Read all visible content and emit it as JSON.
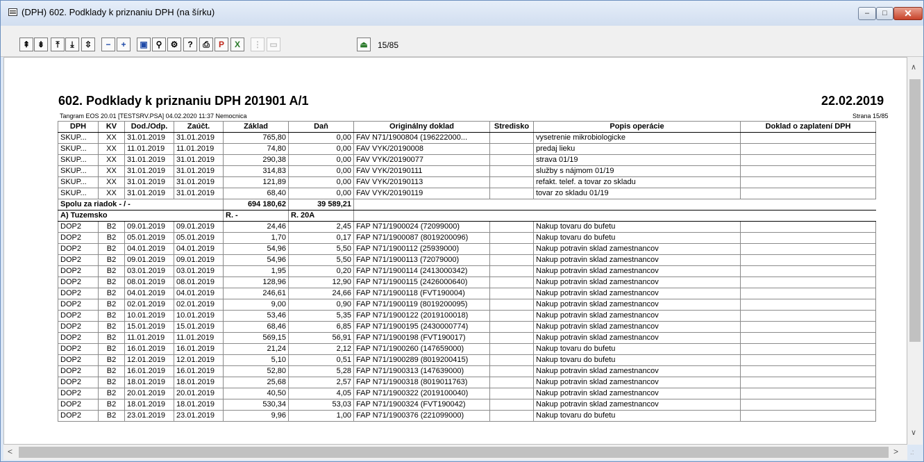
{
  "window": {
    "title": "(DPH) 602. Podklady k priznaniu DPH (na šírku)",
    "min_label": "–",
    "max_label": "□",
    "close_label": "✕"
  },
  "toolbar": {
    "buttons": [
      {
        "name": "first-page-icon",
        "glyph": "⇞"
      },
      {
        "name": "last-page-icon",
        "glyph": "⇟"
      },
      {
        "name": "prev-page-icon",
        "glyph": "⤒"
      },
      {
        "name": "next-page-icon",
        "glyph": "⤓"
      },
      {
        "name": "goto-page-icon",
        "glyph": "⇳"
      },
      {
        "name": "zoom-out-icon",
        "glyph": "−"
      },
      {
        "name": "zoom-in-icon",
        "glyph": "+"
      },
      {
        "name": "screen-icon",
        "glyph": "▣"
      },
      {
        "name": "search-icon",
        "glyph": "⚲"
      },
      {
        "name": "page-setup-icon",
        "glyph": "⚙"
      },
      {
        "name": "help-icon",
        "glyph": "?"
      },
      {
        "name": "print-icon",
        "glyph": "⎙"
      },
      {
        "name": "pdf-export-icon",
        "glyph": "P"
      },
      {
        "name": "excel-export-icon",
        "glyph": "X"
      },
      {
        "name": "disabled-tool-icon",
        "glyph": "⋮"
      },
      {
        "name": "disabled-doc-icon",
        "glyph": "▭"
      },
      {
        "name": "exit-icon",
        "glyph": "⏏"
      }
    ],
    "page_count": "15/85"
  },
  "report": {
    "title": "602. Podklady k priznaniu DPH 201901 A/1",
    "date": "22.02.2019",
    "subtitle": "Tangram EOS 20.01 [TESTSRV.PSA] 04.02.2020 11:37  Nemocnica",
    "page": "Strana 15/85",
    "columns": [
      "DPH",
      "KV",
      "Dod./Odp.",
      "Zaúčt.",
      "Základ",
      "Daň",
      "Originálny doklad",
      "Stredisko",
      "Popis operácie",
      "Doklad o zaplatení DPH"
    ],
    "rows_top": [
      [
        "SKUP...",
        "XX",
        "31.01.2019",
        "31.01.2019",
        "765,80",
        "0,00",
        "FAV N71/1900804 (196222000...",
        "",
        "vysetrenie mikrobiologicke",
        ""
      ],
      [
        "SKUP...",
        "XX",
        "11.01.2019",
        "11.01.2019",
        "74,80",
        "0,00",
        "FAV VYK/20190008",
        "",
        "predaj lieku",
        ""
      ],
      [
        "SKUP...",
        "XX",
        "31.01.2019",
        "31.01.2019",
        "290,38",
        "0,00",
        "FAV VYK/20190077",
        "",
        "strava 01/19",
        ""
      ],
      [
        "SKUP...",
        "XX",
        "31.01.2019",
        "31.01.2019",
        "314,83",
        "0,00",
        "FAV VYK/20190111",
        "",
        "služby s nájmom 01/19",
        ""
      ],
      [
        "SKUP...",
        "XX",
        "31.01.2019",
        "31.01.2019",
        "121,89",
        "0,00",
        "FAV VYK/20190113",
        "",
        "refakt. telef. a tovar zo skladu",
        ""
      ],
      [
        "SKUP...",
        "XX",
        "31.01.2019",
        "31.01.2019",
        "68,40",
        "0,00",
        "FAV VYK/20190119",
        "",
        "tovar zo skladu 01/19",
        ""
      ]
    ],
    "total": {
      "label": "Spolu za riadok - / -",
      "zaklad": "694 180,62",
      "dan": "39 589,21"
    },
    "section": {
      "label": "A) Tuzemsko",
      "r1": "R. -",
      "r2": "R. 20A"
    },
    "rows_bottom": [
      [
        "DOP2",
        "B2",
        "09.01.2019",
        "09.01.2019",
        "24,46",
        "2,45",
        "FAP N71/1900024 (72099000)",
        "",
        "Nakup tovaru do bufetu",
        ""
      ],
      [
        "DOP2",
        "B2",
        "05.01.2019",
        "05.01.2019",
        "1,70",
        "0,17",
        "FAP N71/1900087 (8019200096)",
        "",
        "Nakup tovaru do bufetu",
        ""
      ],
      [
        "DOP2",
        "B2",
        "04.01.2019",
        "04.01.2019",
        "54,96",
        "5,50",
        "FAP N71/1900112 (25939000)",
        "",
        "Nakup potravin sklad zamestnancov",
        ""
      ],
      [
        "DOP2",
        "B2",
        "09.01.2019",
        "09.01.2019",
        "54,96",
        "5,50",
        "FAP N71/1900113 (72079000)",
        "",
        "Nakup potravin sklad zamestnancov",
        ""
      ],
      [
        "DOP2",
        "B2",
        "03.01.2019",
        "03.01.2019",
        "1,95",
        "0,20",
        "FAP N71/1900114 (2413000342)",
        "",
        "Nakup potravin sklad zamestnancov",
        ""
      ],
      [
        "DOP2",
        "B2",
        "08.01.2019",
        "08.01.2019",
        "128,96",
        "12,90",
        "FAP N71/1900115 (2426000640)",
        "",
        "Nakup potravin sklad zamestnancov",
        ""
      ],
      [
        "DOP2",
        "B2",
        "04.01.2019",
        "04.01.2019",
        "246,61",
        "24,66",
        "FAP N71/1900118 (FVT190004)",
        "",
        "Nakup potravin sklad zamestnancov",
        ""
      ],
      [
        "DOP2",
        "B2",
        "02.01.2019",
        "02.01.2019",
        "9,00",
        "0,90",
        "FAP N71/1900119 (8019200095)",
        "",
        "Nakup potravin sklad zamestnancov",
        ""
      ],
      [
        "DOP2",
        "B2",
        "10.01.2019",
        "10.01.2019",
        "53,46",
        "5,35",
        "FAP N71/1900122 (2019100018)",
        "",
        "Nakup potravin sklad zamestnancov",
        ""
      ],
      [
        "DOP2",
        "B2",
        "15.01.2019",
        "15.01.2019",
        "68,46",
        "6,85",
        "FAP N71/1900195 (2430000774)",
        "",
        "Nakup potravin sklad zamestnancov",
        ""
      ],
      [
        "DOP2",
        "B2",
        "11.01.2019",
        "11.01.2019",
        "569,15",
        "56,91",
        "FAP N71/1900198 (FVT190017)",
        "",
        "Nakup potravin sklad zamestnancov",
        ""
      ],
      [
        "DOP2",
        "B2",
        "16.01.2019",
        "16.01.2019",
        "21,24",
        "2,12",
        "FAP N71/1900260 (147659000)",
        "",
        "Nakup tovaru do bufetu",
        ""
      ],
      [
        "DOP2",
        "B2",
        "12.01.2019",
        "12.01.2019",
        "5,10",
        "0,51",
        "FAP N71/1900289 (8019200415)",
        "",
        "Nakup tovaru do bufetu",
        ""
      ],
      [
        "DOP2",
        "B2",
        "16.01.2019",
        "16.01.2019",
        "52,80",
        "5,28",
        "FAP N71/1900313 (147639000)",
        "",
        "Nakup potravin sklad zamestnancov",
        ""
      ],
      [
        "DOP2",
        "B2",
        "18.01.2019",
        "18.01.2019",
        "25,68",
        "2,57",
        "FAP N71/1900318 (8019011763)",
        "",
        "Nakup potravin sklad zamestnancov",
        ""
      ],
      [
        "DOP2",
        "B2",
        "20.01.2019",
        "20.01.2019",
        "40,50",
        "4,05",
        "FAP N71/1900322 (2019100040)",
        "",
        "Nakup potravin sklad zamestnancov",
        ""
      ],
      [
        "DOP2",
        "B2",
        "18.01.2019",
        "18.01.2019",
        "530,34",
        "53,03",
        "FAP N71/1900324 (FVT190042)",
        "",
        "Nakup potravin sklad zamestnancov",
        ""
      ],
      [
        "DOP2",
        "B2",
        "23.01.2019",
        "23.01.2019",
        "9,96",
        "1,00",
        "FAP N71/1900376 (221099000)",
        "",
        "Nakup tovaru do bufetu",
        ""
      ]
    ]
  },
  "scrollbars": {
    "up": "∧",
    "down": "∨",
    "left": "<",
    "right": ">",
    "grip": ".:"
  }
}
